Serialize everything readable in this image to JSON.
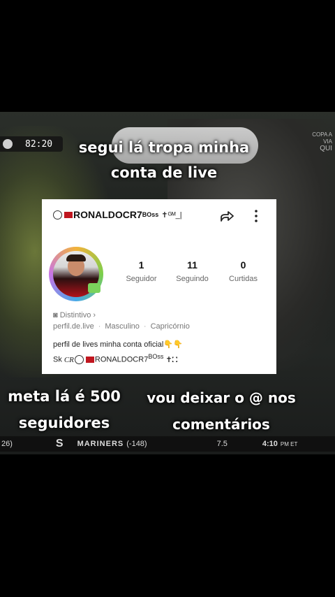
{
  "overlay": {
    "top_caption_line1": "segui lá tropa minha",
    "top_caption_line2": "conta de live",
    "bottom_left_line1": "meta lá é 500",
    "bottom_left_line2": "seguidores",
    "bottom_right_line1": "vou deixar o @ nos",
    "bottom_right_line2": "comentários"
  },
  "broadcast": {
    "clock": "82:20",
    "corner_line1": "COPA A",
    "corner_line2": "VIA",
    "corner_line3": "QUI",
    "ticker": {
      "left_num": "26)",
      "small1": "",
      "team": "MARINERS",
      "odds": "(-148)",
      "small2": "",
      "score": "7.5",
      "time": "4:10",
      "time_suffix": "PM ET"
    }
  },
  "profile": {
    "username": "RONALDOCR7",
    "username_sup": "BOss",
    "username_suffix": "✝ᴳᴹ_|",
    "stats": [
      {
        "value": "1",
        "label": "Seguidor"
      },
      {
        "value": "11",
        "label": "Seguindo"
      },
      {
        "value": "0",
        "label": "Curtidas"
      }
    ],
    "badge_label": "Distintivo",
    "info": {
      "site": "perfil.de.live",
      "gender": "Masculino",
      "sign": "Capricórnio"
    },
    "bio_line1": "perfil de lives minha conta oficial",
    "bio_line1_emoji": "👇👇",
    "bio_line2_prefix": "Sk",
    "bio_line2_mid": "CR",
    "bio_line2_name": "RONALDOCR7",
    "bio_line2_sup": "BOss",
    "bio_line2_suffix": "✝⛚"
  },
  "icons": {
    "share": "share-arrow-icon",
    "menu": "more-vertical-icon",
    "badge": "badge-icon",
    "avatar": "avatar-image"
  }
}
